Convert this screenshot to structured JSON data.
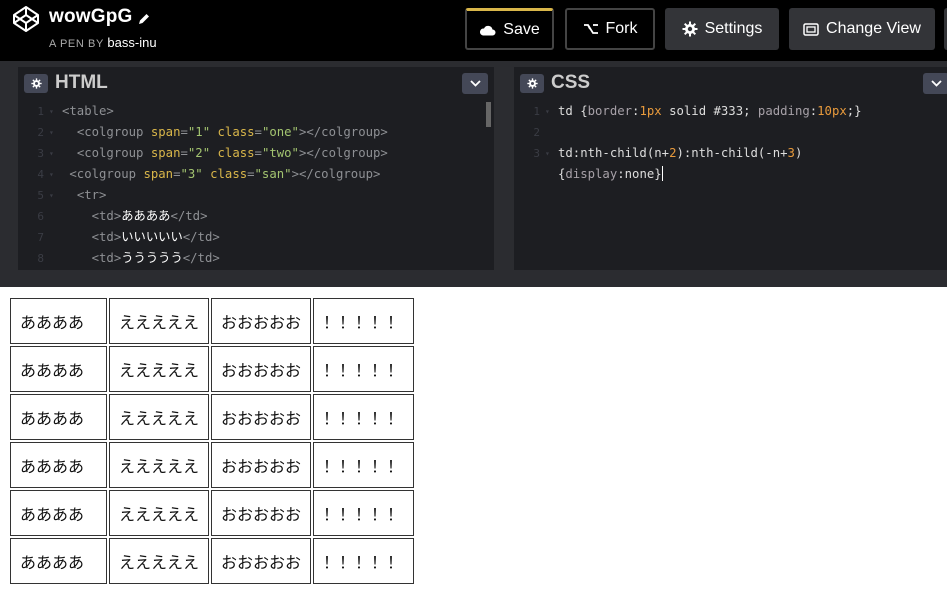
{
  "header": {
    "pen_title": "wowGpG",
    "byline_prefix": "A PEN BY",
    "author": "bass-inu",
    "buttons": {
      "save": "Save",
      "fork": "Fork",
      "settings": "Settings",
      "change_view": "Change View"
    },
    "icons": [
      "codepen-logo-icon",
      "pencil-icon",
      "cloud-icon",
      "fork-icon",
      "gear-icon",
      "layout-icon"
    ]
  },
  "html_editor": {
    "title": "HTML",
    "lines": [
      {
        "num": "1",
        "fold": "▾",
        "indent": "",
        "tokens": [
          {
            "t": "<table>",
            "c": "tg"
          }
        ]
      },
      {
        "num": "2",
        "fold": "▾",
        "indent": "  ",
        "tokens": [
          {
            "t": "<colgroup ",
            "c": "tg"
          },
          {
            "t": "span",
            "c": "at"
          },
          {
            "t": "=",
            "c": "tg"
          },
          {
            "t": "\"1\"",
            "c": "st"
          },
          {
            "t": " class",
            "c": "at"
          },
          {
            "t": "=",
            "c": "tg"
          },
          {
            "t": "\"one\"",
            "c": "st"
          },
          {
            "t": "></colgroup>",
            "c": "tg"
          }
        ]
      },
      {
        "num": "3",
        "fold": "▾",
        "indent": "  ",
        "tokens": [
          {
            "t": "<colgroup ",
            "c": "tg"
          },
          {
            "t": "span",
            "c": "at"
          },
          {
            "t": "=",
            "c": "tg"
          },
          {
            "t": "\"2\"",
            "c": "st"
          },
          {
            "t": " class",
            "c": "at"
          },
          {
            "t": "=",
            "c": "tg"
          },
          {
            "t": "\"two\"",
            "c": "st"
          },
          {
            "t": "></colgroup>",
            "c": "tg"
          }
        ]
      },
      {
        "num": "4",
        "fold": "▾",
        "indent": " ",
        "tokens": [
          {
            "t": "<colgroup ",
            "c": "tg"
          },
          {
            "t": "span",
            "c": "at"
          },
          {
            "t": "=",
            "c": "tg"
          },
          {
            "t": "\"3\"",
            "c": "st"
          },
          {
            "t": " class",
            "c": "at"
          },
          {
            "t": "=",
            "c": "tg"
          },
          {
            "t": "\"san\"",
            "c": "st"
          },
          {
            "t": "></colgroup>",
            "c": "tg"
          }
        ]
      },
      {
        "num": "5",
        "fold": "▾",
        "indent": "  ",
        "tokens": [
          {
            "t": "<tr>",
            "c": "tg"
          }
        ]
      },
      {
        "num": "6",
        "fold": "",
        "indent": "    ",
        "tokens": [
          {
            "t": "<td>",
            "c": "tg"
          },
          {
            "t": "ああああ",
            "c": "jp"
          },
          {
            "t": "</td>",
            "c": "tg"
          }
        ]
      },
      {
        "num": "7",
        "fold": "",
        "indent": "    ",
        "tokens": [
          {
            "t": "<td>",
            "c": "tg"
          },
          {
            "t": "いいいいい",
            "c": "jp"
          },
          {
            "t": "</td>",
            "c": "tg"
          }
        ]
      },
      {
        "num": "8",
        "fold": "",
        "indent": "    ",
        "tokens": [
          {
            "t": "<td>",
            "c": "tg"
          },
          {
            "t": "ううううう",
            "c": "jp"
          },
          {
            "t": "</td>",
            "c": "tg"
          }
        ]
      }
    ]
  },
  "css_editor": {
    "title": "CSS",
    "lines": [
      {
        "num": "1",
        "fold": "▾",
        "tokens": [
          {
            "t": "td ",
            "c": "plain"
          },
          {
            "t": "{",
            "c": "plain"
          },
          {
            "t": "border",
            "c": "kw"
          },
          {
            "t": ":",
            "c": "plain"
          },
          {
            "t": "1px",
            "c": "num"
          },
          {
            "t": " solid #333",
            "c": "plain"
          },
          {
            "t": "; ",
            "c": "plain"
          },
          {
            "t": "padding",
            "c": "kw"
          },
          {
            "t": ":",
            "c": "plain"
          },
          {
            "t": "10px",
            "c": "num"
          },
          {
            "t": ";}",
            "c": "plain"
          }
        ]
      },
      {
        "num": "2",
        "fold": "",
        "tokens": []
      },
      {
        "num": "3",
        "fold": "▾",
        "tokens": [
          {
            "t": "td:nth-child(n+",
            "c": "plain"
          },
          {
            "t": "2",
            "c": "num"
          },
          {
            "t": "):nth-child(-n+",
            "c": "plain"
          },
          {
            "t": "3",
            "c": "num"
          },
          {
            "t": ")",
            "c": "plain"
          }
        ]
      },
      {
        "num": "",
        "fold": "",
        "tokens": [
          {
            "t": "{",
            "c": "plain"
          },
          {
            "t": "display",
            "c": "kw"
          },
          {
            "t": ":none}",
            "c": "plain"
          }
        ],
        "cursor": true
      }
    ]
  },
  "preview": {
    "rows": [
      [
        "ああああ",
        "えええええ",
        "おおおおお",
        "！！！！！"
      ],
      [
        "ああああ",
        "えええええ",
        "おおおおお",
        "！！！！！"
      ],
      [
        "ああああ",
        "えええええ",
        "おおおおお",
        "！！！！！"
      ],
      [
        "ああああ",
        "えええええ",
        "おおおおお",
        "！！！！！"
      ],
      [
        "ああああ",
        "えええええ",
        "おおおおお",
        "！！！！！"
      ],
      [
        "ああああ",
        "えええええ",
        "おおおおお",
        "！！！！！"
      ]
    ]
  },
  "colors": {
    "header_bg": "#000000",
    "editor_bg": "#1d1e22",
    "chrome_bg": "#2b2c30",
    "save_accent": "#d9b64a",
    "button_bg": "#333438"
  }
}
